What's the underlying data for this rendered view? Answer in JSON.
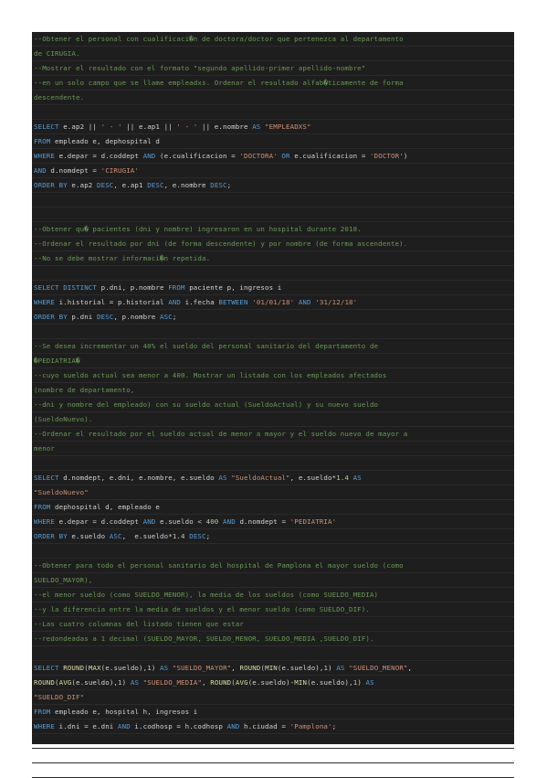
{
  "colors": {
    "background": "#1e1e1e",
    "comment": "#6a9955",
    "keyword": "#569cd6",
    "string": "#ce9178",
    "function": "#dcdcaa",
    "number": "#b5cea8",
    "identifier": "#d4d4d4"
  },
  "lines": [
    [
      [
        "c",
        "--Obtener el personal con cualificaci�n de doctora/doctor que pertenezca al departamento"
      ]
    ],
    [
      [
        "c",
        "de CIRUGIA."
      ]
    ],
    [
      [
        "c",
        "--Mostrar el resultado con el formato \"segundo apellido-primer apellido-nombre\""
      ]
    ],
    [
      [
        "c",
        "--en un solo campo que se llame empleadxs. Ordenar el resultado alfab�ticamente de forma"
      ]
    ],
    [
      [
        "c",
        "descendente."
      ]
    ],
    [],
    [
      [
        "k",
        "SELECT"
      ],
      [
        "i",
        " e.ap2 || "
      ],
      [
        "s",
        "' - '"
      ],
      [
        "i",
        " || e.ap1 || "
      ],
      [
        "s",
        "' - '"
      ],
      [
        "i",
        " || e.nombre "
      ],
      [
        "k",
        "AS"
      ],
      [
        "i",
        " "
      ],
      [
        "s",
        "\"EMPLEADXS\""
      ]
    ],
    [
      [
        "k",
        "FROM"
      ],
      [
        "i",
        " empleado e, dephospital d"
      ]
    ],
    [
      [
        "k",
        "WHERE"
      ],
      [
        "i",
        " e.depar = d.coddept "
      ],
      [
        "k",
        "AND"
      ],
      [
        "i",
        " (e.cualificacion = "
      ],
      [
        "s",
        "'DOCTORA'"
      ],
      [
        "i",
        " "
      ],
      [
        "k",
        "OR"
      ],
      [
        "i",
        " e.cualificacion = "
      ],
      [
        "s",
        "'DOCTOR'"
      ],
      [
        "i",
        ")"
      ]
    ],
    [
      [
        "k",
        "AND"
      ],
      [
        "i",
        " d.nomdept = "
      ],
      [
        "s",
        "'CIRUGIA'"
      ]
    ],
    [
      [
        "k",
        "ORDER BY"
      ],
      [
        "i",
        " e.ap2 "
      ],
      [
        "k",
        "DESC"
      ],
      [
        "i",
        ", e.ap1 "
      ],
      [
        "k",
        "DESC"
      ],
      [
        "i",
        ", e.nombre "
      ],
      [
        "k",
        "DESC"
      ],
      [
        "i",
        ";"
      ]
    ],
    [],
    [],
    [
      [
        "c",
        "--Obtener qu� pacientes (dni y nombre) ingresaron en un hospital durante 2018."
      ]
    ],
    [
      [
        "c",
        "--Ordenar el resultado por dni (de forma descendente) y por nombre (de forma ascendente)."
      ]
    ],
    [
      [
        "c",
        "--No se debe mostrar informaci�n repetida."
      ]
    ],
    [],
    [
      [
        "k",
        "SELECT DISTINCT"
      ],
      [
        "i",
        " p.dni, p.nombre "
      ],
      [
        "k",
        "FROM"
      ],
      [
        "i",
        " paciente p, ingresos i"
      ]
    ],
    [
      [
        "k",
        "WHERE"
      ],
      [
        "i",
        " i.historial = p.historial "
      ],
      [
        "k",
        "AND"
      ],
      [
        "i",
        " i.fecha "
      ],
      [
        "k",
        "BETWEEN"
      ],
      [
        "i",
        " "
      ],
      [
        "s",
        "'01/01/18'"
      ],
      [
        "i",
        " "
      ],
      [
        "k",
        "AND"
      ],
      [
        "i",
        " "
      ],
      [
        "s",
        "'31/12/18'"
      ]
    ],
    [
      [
        "k",
        "ORDER BY"
      ],
      [
        "i",
        " p.dni "
      ],
      [
        "k",
        "DESC"
      ],
      [
        "i",
        ", p.nombre "
      ],
      [
        "k",
        "ASC"
      ],
      [
        "i",
        ";"
      ]
    ],
    [],
    [
      [
        "c",
        "--Se desea incrementar un 40% el sueldo del personal sanitario del departamento de"
      ]
    ],
    [
      [
        "c",
        "�PEDIATRIA�"
      ]
    ],
    [
      [
        "c",
        "--cuyo sueldo actual sea menor a 400. Mostrar un listado con los empleados afectados"
      ]
    ],
    [
      [
        "c",
        "(nombre de departamento,"
      ]
    ],
    [
      [
        "c",
        "--dni y nombre del empleado) con su sueldo actual (SueldoActual) y su nuevo sueldo"
      ]
    ],
    [
      [
        "c",
        "(SueldoNuevo)."
      ]
    ],
    [
      [
        "c",
        "--Ordenar el resultado por el sueldo actual de menor a mayor y el sueldo nuevo de mayor a"
      ]
    ],
    [
      [
        "c",
        "menor"
      ]
    ],
    [],
    [
      [
        "k",
        "SELECT"
      ],
      [
        "i",
        " d.nomdept, e.dni, e.nombre, e.sueldo "
      ],
      [
        "k",
        "AS"
      ],
      [
        "i",
        " "
      ],
      [
        "s",
        "\"SueldoActual\""
      ],
      [
        "i",
        ", e.sueldo*"
      ],
      [
        "n",
        "1.4"
      ],
      [
        "i",
        " "
      ],
      [
        "k",
        "AS"
      ]
    ],
    [
      [
        "s",
        "\"SueldoNuevo\""
      ]
    ],
    [
      [
        "k",
        "FROM"
      ],
      [
        "i",
        " dephospital d, empleado e"
      ]
    ],
    [
      [
        "k",
        "WHERE"
      ],
      [
        "i",
        " e.depar = d.coddept "
      ],
      [
        "k",
        "AND"
      ],
      [
        "i",
        " e.sueldo < "
      ],
      [
        "n",
        "400"
      ],
      [
        "i",
        " "
      ],
      [
        "k",
        "AND"
      ],
      [
        "i",
        " d.nomdept = "
      ],
      [
        "s",
        "'PEDIATRIA'"
      ]
    ],
    [
      [
        "k",
        "ORDER BY"
      ],
      [
        "i",
        " e.sueldo "
      ],
      [
        "k",
        "ASC"
      ],
      [
        "i",
        ",  e.sueldo*"
      ],
      [
        "n",
        "1.4"
      ],
      [
        "i",
        " "
      ],
      [
        "k",
        "DESC"
      ],
      [
        "i",
        ";"
      ]
    ],
    [],
    [
      [
        "c",
        "--Obtener para todo el personal sanitario del hospital de Pamplona el mayor sueldo (como"
      ]
    ],
    [
      [
        "c",
        "SUELDO_MAYOR),"
      ]
    ],
    [
      [
        "c",
        "--el menor sueldo (como SUELDO_MENOR), la media de los sueldos (como SUELDO_MEDIA)"
      ]
    ],
    [
      [
        "c",
        "--y la diferencia entre la media de sueldos y el menor sueldo (como SUELDO_DIF)."
      ]
    ],
    [
      [
        "c",
        "--Las cuatro columnas del listado tienen que estar"
      ]
    ],
    [
      [
        "c",
        "--redondeadas a 1 decimal (SUELDO_MAYOR, SUELDO_MENOR, SUELDO_MEDIA ,SUELDO_DIF)."
      ]
    ],
    [],
    [
      [
        "k",
        "SELECT"
      ],
      [
        "i",
        " "
      ],
      [
        "f",
        "ROUND"
      ],
      [
        "i",
        "("
      ],
      [
        "f",
        "MAX"
      ],
      [
        "i",
        "(e.sueldo),"
      ],
      [
        "n",
        "1"
      ],
      [
        "i",
        ") "
      ],
      [
        "k",
        "AS"
      ],
      [
        "i",
        " "
      ],
      [
        "s",
        "\"SUELDO_MAYOR\""
      ],
      [
        "i",
        ", "
      ],
      [
        "f",
        "ROUND"
      ],
      [
        "i",
        "("
      ],
      [
        "f",
        "MIN"
      ],
      [
        "i",
        "(e.sueldo),"
      ],
      [
        "n",
        "1"
      ],
      [
        "i",
        ") "
      ],
      [
        "k",
        "AS"
      ],
      [
        "i",
        " "
      ],
      [
        "s",
        "\"SUELDO_MENOR\""
      ],
      [
        "i",
        ","
      ]
    ],
    [
      [
        "f",
        "ROUND"
      ],
      [
        "i",
        "("
      ],
      [
        "f",
        "AVG"
      ],
      [
        "i",
        "(e.sueldo),"
      ],
      [
        "n",
        "1"
      ],
      [
        "i",
        ") "
      ],
      [
        "k",
        "AS"
      ],
      [
        "i",
        " "
      ],
      [
        "s",
        "\"SUELDO_MEDIA\""
      ],
      [
        "i",
        ", "
      ],
      [
        "f",
        "ROUND"
      ],
      [
        "i",
        "("
      ],
      [
        "f",
        "AVG"
      ],
      [
        "i",
        "(e.sueldo)-"
      ],
      [
        "f",
        "MIN"
      ],
      [
        "i",
        "(e.sueldo),"
      ],
      [
        "n",
        "1"
      ],
      [
        "i",
        ") "
      ],
      [
        "k",
        "AS"
      ]
    ],
    [
      [
        "s",
        "\"SUELDO_DIF\""
      ]
    ],
    [
      [
        "k",
        "FROM"
      ],
      [
        "i",
        " empleado e, hospital h, ingresos i"
      ]
    ],
    [
      [
        "k",
        "WHERE"
      ],
      [
        "i",
        " i.dni = e.dni "
      ],
      [
        "k",
        "AND"
      ],
      [
        "i",
        " i.codhosp = h.codhosp "
      ],
      [
        "k",
        "AND"
      ],
      [
        "i",
        " h.ciudad = "
      ],
      [
        "s",
        "'Pamplona'"
      ],
      [
        "i",
        ";"
      ]
    ],
    [],
    [],
    []
  ]
}
